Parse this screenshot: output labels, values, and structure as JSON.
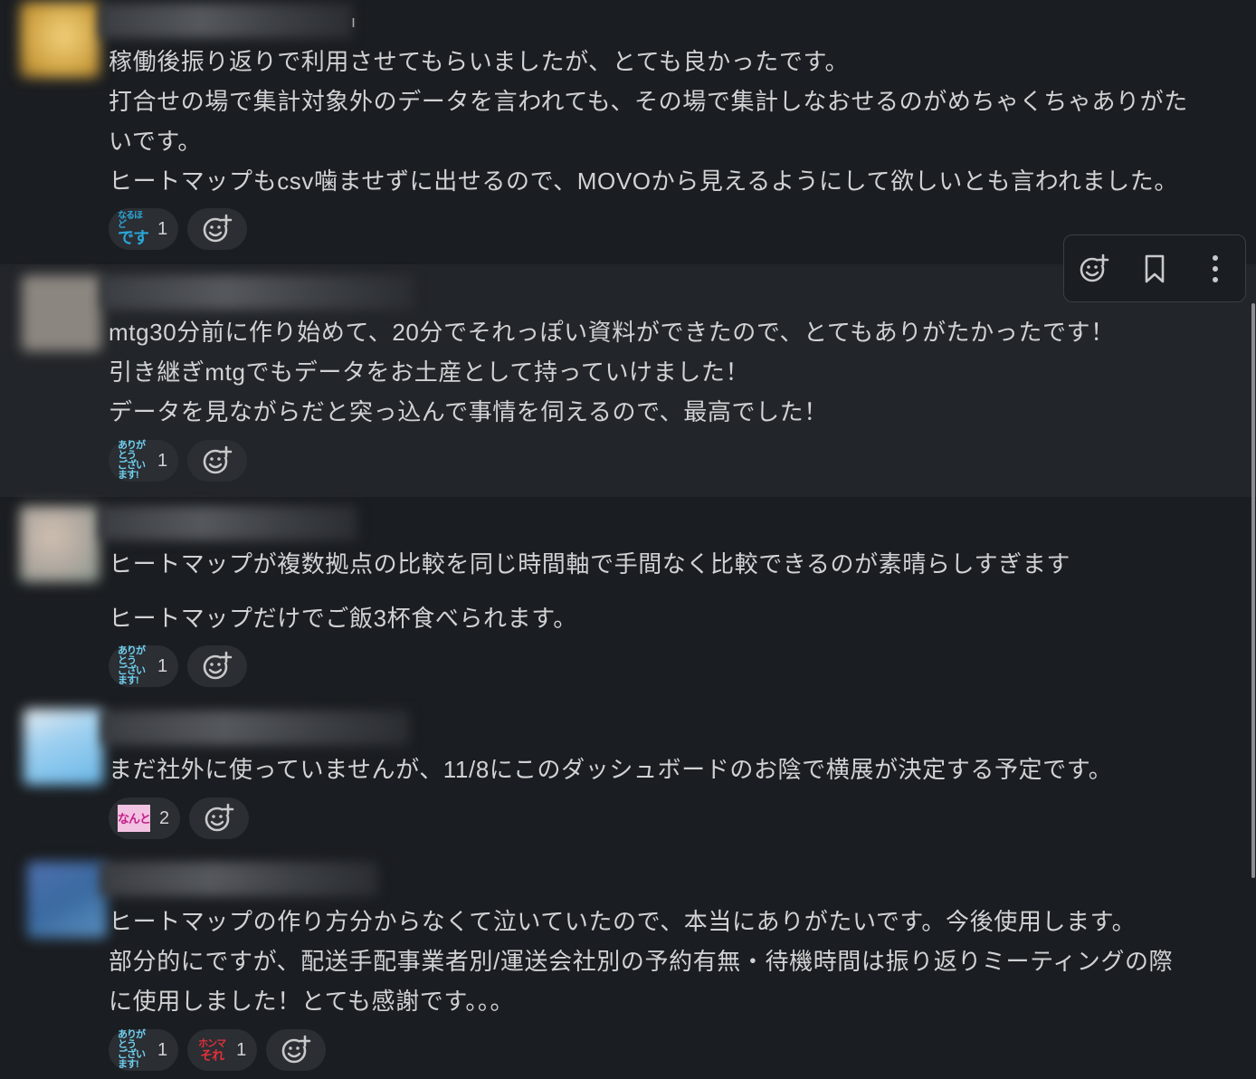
{
  "messages": [
    {
      "lines": [
        "稼働後振り返りで利用させてもらいましたが、とても良かったです。",
        "打合せの場で集計対象外のデータを言われても、その場で集計しなおせるのがめちゃくちゃありがた",
        "いです。",
        "ヒートマップもcsv噛ませずに出せるので、MOVOから見えるようにして欲しいとも言われました。"
      ],
      "reactions": [
        {
          "emoji": "naruhodo-desu",
          "top": "なるほど",
          "bottom": "です",
          "count": "1"
        }
      ]
    },
    {
      "lines": [
        "mtg30分前に作り始めて、20分でそれっぽい資料ができたので、とてもありがたかったです！",
        "引き継ぎmtgでもデータをお土産として持っていけました！",
        "データを見ながらだと突っ込んで事情を伺えるので、最高でした！"
      ],
      "reactions": [
        {
          "emoji": "arigatou-gozaimasu",
          "top": "ありがとう",
          "bottom": "ございます!",
          "count": "1"
        }
      ]
    },
    {
      "lines": [
        "ヒートマップが複数拠点の比較を同じ時間軸で手間なく比較できるのが素晴らしすぎます",
        "ヒートマップだけでご飯3杯食べられます。"
      ],
      "reactions": [
        {
          "emoji": "arigatou-gozaimasu",
          "top": "ありがとう",
          "bottom": "ございます!",
          "count": "1"
        }
      ]
    },
    {
      "lines": [
        "まだ社外に使っていませんが、11/8にこのダッシュボードのお陰で横展が決定する予定です。"
      ],
      "reactions": [
        {
          "emoji": "nanto",
          "top": "なんと",
          "bottom": "",
          "count": "2"
        }
      ]
    },
    {
      "lines": [
        "ヒートマップの作り方分からなくて泣いていたので、本当にありがたいです。今後使用します。",
        "部分的にですが、配送手配事業者別/運送会社別の予約有無・待機時間は振り返りミーティングの際",
        "に使用しました！とても感謝です。。。"
      ],
      "reactions": [
        {
          "emoji": "arigatou-gozaimasu",
          "top": "ありがとう",
          "bottom": "ございます!",
          "count": "1"
        },
        {
          "emoji": "honma-sore",
          "top": "ホンマ",
          "bottom": "それ",
          "count": "1"
        }
      ]
    }
  ],
  "toolbar": {
    "add_reaction": "add-reaction-icon",
    "save": "bookmark-icon",
    "more": "more-actions-icon"
  },
  "colors": {
    "background": "#1a1d21",
    "hover_background": "#222529",
    "text": "#d1d2d3",
    "reaction_pill": "#2b2e33"
  }
}
